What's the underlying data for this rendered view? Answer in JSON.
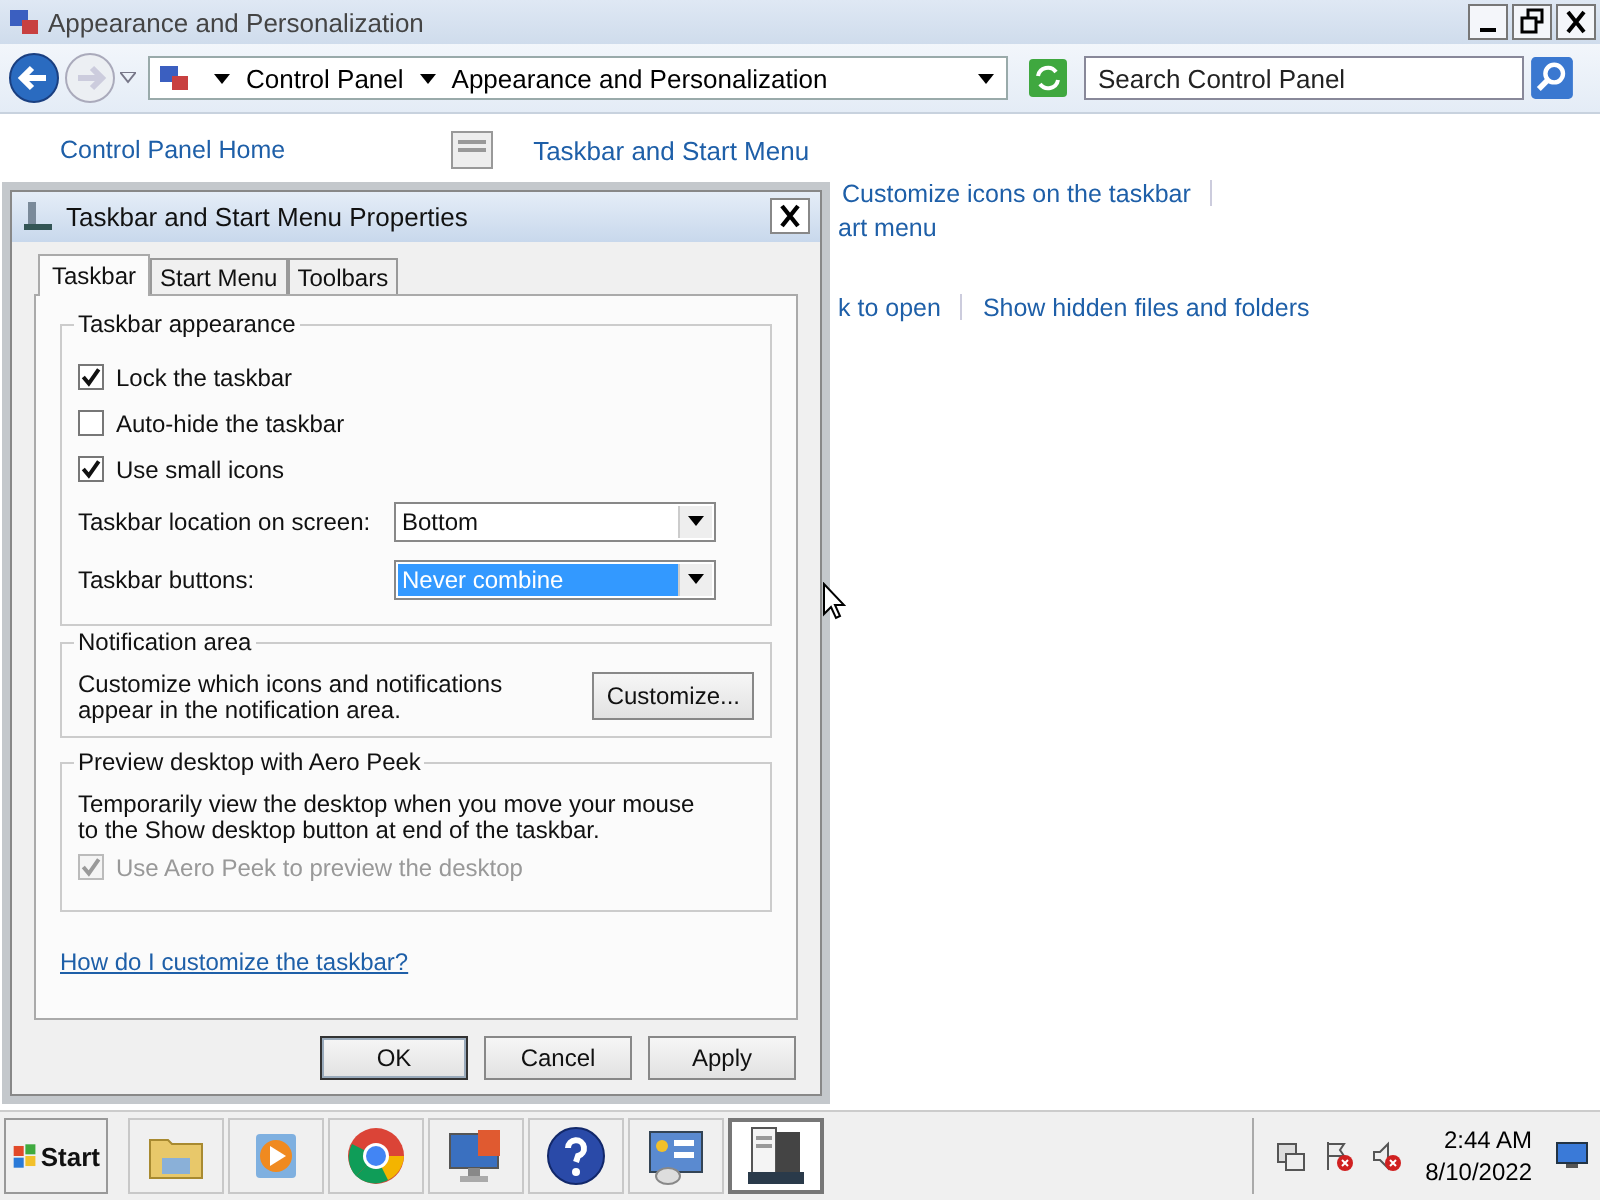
{
  "window": {
    "title": "Appearance and Personalization"
  },
  "address_bar": {
    "crumbs": [
      "Control Panel",
      "Appearance and Personalization"
    ]
  },
  "search": {
    "placeholder": "Search Control Panel"
  },
  "content": {
    "sidebar_link": "Control Panel Home",
    "heading_link": "Taskbar and Start Menu",
    "rows": [
      {
        "links": [
          "Customize icons on the taskbar"
        ],
        "trailing_separator": true
      },
      {
        "links": [
          "art menu"
        ],
        "trailing_separator": false
      },
      {
        "links": [
          "k to open",
          "Show hidden files and folders"
        ],
        "trailing_separator": false
      }
    ]
  },
  "dialog": {
    "title": "Taskbar and Start Menu Properties",
    "tabs": [
      {
        "label": "Taskbar",
        "selected": true
      },
      {
        "label": "Start Menu",
        "selected": false
      },
      {
        "label": "Toolbars",
        "selected": false
      }
    ],
    "appearance": {
      "title": "Taskbar appearance",
      "checkboxes": [
        {
          "label": "Lock the taskbar",
          "checked": true
        },
        {
          "label": "Auto-hide the taskbar",
          "checked": false
        },
        {
          "label": "Use small icons",
          "checked": true
        }
      ],
      "selects": [
        {
          "label": "Taskbar location on screen:",
          "value": "Bottom",
          "focused": false
        },
        {
          "label": "Taskbar buttons:",
          "value": "Never combine",
          "focused": true
        }
      ]
    },
    "notification": {
      "title": "Notification area",
      "text": "Customize which icons and notifications appear in the notification area.",
      "button": "Customize..."
    },
    "peek": {
      "title": "Preview desktop with Aero Peek",
      "text": "Temporarily view the desktop when you move your mouse to the Show desktop button at end of the taskbar.",
      "checkbox": {
        "label": "Use Aero Peek to preview the desktop",
        "checked": true,
        "disabled": true
      }
    },
    "help_link": "How do I customize the taskbar?",
    "buttons": [
      {
        "label": "OK",
        "default": true
      },
      {
        "label": "Cancel",
        "default": false
      },
      {
        "label": "Apply",
        "default": false
      }
    ]
  },
  "taskbar": {
    "start": "Start",
    "apps": [
      {
        "kind": "folder",
        "active": false
      },
      {
        "kind": "media",
        "active": false
      },
      {
        "kind": "browser",
        "active": false
      },
      {
        "kind": "monitor",
        "active": false
      },
      {
        "kind": "help",
        "active": false
      },
      {
        "kind": "panel",
        "active": false
      },
      {
        "kind": "server",
        "active": true
      }
    ],
    "tray": [
      {
        "kind": "network"
      },
      {
        "kind": "flag"
      },
      {
        "kind": "speaker"
      }
    ],
    "time": "2:44 AM",
    "date": "8/10/2022"
  }
}
